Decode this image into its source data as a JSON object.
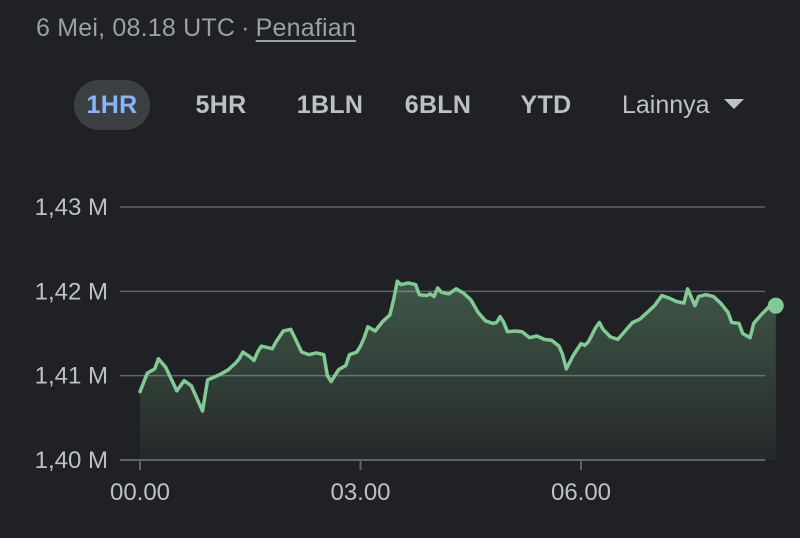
{
  "header": {
    "timestamp": "6 Mei, 08.18 UTC",
    "separator": "·",
    "disclaimer_link": "Penafian"
  },
  "range_tabs": [
    {
      "label": "1HR",
      "active": true
    },
    {
      "label": "5HR",
      "active": false
    },
    {
      "label": "1BLN",
      "active": false
    },
    {
      "label": "6BLN",
      "active": false
    },
    {
      "label": "YTD",
      "active": false
    }
  ],
  "more_tab": {
    "label": "Lainnya",
    "icon": "chevron-down-icon"
  },
  "colors": {
    "background": "#202124",
    "line": "#81c995",
    "active_tab_bg": "#3c4043",
    "active_tab_text": "#8ab4f8",
    "gridline": "#5f6368"
  },
  "chart_data": {
    "type": "area",
    "y_tick_labels": [
      "1,40 M",
      "1,41 M",
      "1,42 M",
      "1,43 M"
    ],
    "y_ticks": [
      1.4,
      1.41,
      1.42,
      1.43
    ],
    "ylim": [
      1.4,
      1.43
    ],
    "x_tick_labels": [
      "00.00",
      "03.00",
      "06.00"
    ],
    "x_ticks": [
      0,
      3,
      6
    ],
    "xlim": [
      0,
      8.4
    ],
    "grid": true,
    "series": [
      {
        "values": [
          [
            0.0,
            1.4081
          ],
          [
            0.1,
            1.4103
          ],
          [
            0.2,
            1.4108
          ],
          [
            0.25,
            1.412
          ],
          [
            0.35,
            1.411
          ],
          [
            0.5,
            1.4082
          ],
          [
            0.6,
            1.4094
          ],
          [
            0.7,
            1.4088
          ],
          [
            0.85,
            1.4058
          ],
          [
            0.92,
            1.4095
          ],
          [
            1.0,
            1.4098
          ],
          [
            1.1,
            1.4102
          ],
          [
            1.2,
            1.4107
          ],
          [
            1.3,
            1.4115
          ],
          [
            1.35,
            1.412
          ],
          [
            1.4,
            1.4128
          ],
          [
            1.5,
            1.4122
          ],
          [
            1.55,
            1.4118
          ],
          [
            1.6,
            1.4128
          ],
          [
            1.65,
            1.4135
          ],
          [
            1.8,
            1.4132
          ],
          [
            1.85,
            1.414
          ],
          [
            1.95,
            1.4153
          ],
          [
            2.05,
            1.4155
          ],
          [
            2.1,
            1.4146
          ],
          [
            2.2,
            1.4128
          ],
          [
            2.3,
            1.4125
          ],
          [
            2.4,
            1.4127
          ],
          [
            2.5,
            1.4125
          ],
          [
            2.55,
            1.41
          ],
          [
            2.6,
            1.4093
          ],
          [
            2.7,
            1.4107
          ],
          [
            2.8,
            1.4112
          ],
          [
            2.85,
            1.4125
          ],
          [
            2.95,
            1.4128
          ],
          [
            3.0,
            1.4135
          ],
          [
            3.05,
            1.4145
          ],
          [
            3.1,
            1.4158
          ],
          [
            3.2,
            1.4153
          ],
          [
            3.3,
            1.4164
          ],
          [
            3.4,
            1.4172
          ],
          [
            3.45,
            1.419
          ],
          [
            3.5,
            1.4212
          ],
          [
            3.55,
            1.4208
          ],
          [
            3.65,
            1.421
          ],
          [
            3.75,
            1.4208
          ],
          [
            3.8,
            1.4196
          ],
          [
            3.9,
            1.4195
          ],
          [
            3.95,
            1.4197
          ],
          [
            4.0,
            1.4194
          ],
          [
            4.05,
            1.4204
          ],
          [
            4.1,
            1.4199
          ],
          [
            4.2,
            1.4197
          ],
          [
            4.3,
            1.4203
          ],
          [
            4.4,
            1.4198
          ],
          [
            4.5,
            1.419
          ],
          [
            4.6,
            1.4175
          ],
          [
            4.7,
            1.4165
          ],
          [
            4.8,
            1.4162
          ],
          [
            4.85,
            1.4163
          ],
          [
            4.9,
            1.417
          ],
          [
            4.95,
            1.4163
          ],
          [
            5.0,
            1.4152
          ],
          [
            5.1,
            1.4153
          ],
          [
            5.2,
            1.4152
          ],
          [
            5.3,
            1.4145
          ],
          [
            5.4,
            1.4147
          ],
          [
            5.5,
            1.4143
          ],
          [
            5.6,
            1.4142
          ],
          [
            5.7,
            1.4135
          ],
          [
            5.75,
            1.4125
          ],
          [
            5.8,
            1.4108
          ],
          [
            5.9,
            1.4125
          ],
          [
            6.0,
            1.4138
          ],
          [
            6.05,
            1.4136
          ],
          [
            6.1,
            1.414
          ],
          [
            6.2,
            1.4157
          ],
          [
            6.25,
            1.4163
          ],
          [
            6.3,
            1.4155
          ],
          [
            6.4,
            1.4146
          ],
          [
            6.5,
            1.4143
          ],
          [
            6.6,
            1.4153
          ],
          [
            6.7,
            1.4163
          ],
          [
            6.8,
            1.4167
          ],
          [
            6.9,
            1.4175
          ],
          [
            7.0,
            1.4183
          ],
          [
            7.1,
            1.4195
          ],
          [
            7.2,
            1.4192
          ],
          [
            7.3,
            1.4188
          ],
          [
            7.4,
            1.4186
          ],
          [
            7.45,
            1.4203
          ],
          [
            7.5,
            1.4193
          ],
          [
            7.55,
            1.4183
          ],
          [
            7.6,
            1.4194
          ],
          [
            7.7,
            1.4196
          ],
          [
            7.8,
            1.4194
          ],
          [
            7.9,
            1.4186
          ],
          [
            8.0,
            1.4175
          ],
          [
            8.05,
            1.4163
          ],
          [
            8.15,
            1.4162
          ],
          [
            8.2,
            1.415
          ],
          [
            8.3,
            1.4145
          ],
          [
            8.35,
            1.4162
          ],
          [
            8.45,
            1.4172
          ],
          [
            8.55,
            1.4181
          ],
          [
            8.65,
            1.4183
          ]
        ]
      }
    ]
  }
}
